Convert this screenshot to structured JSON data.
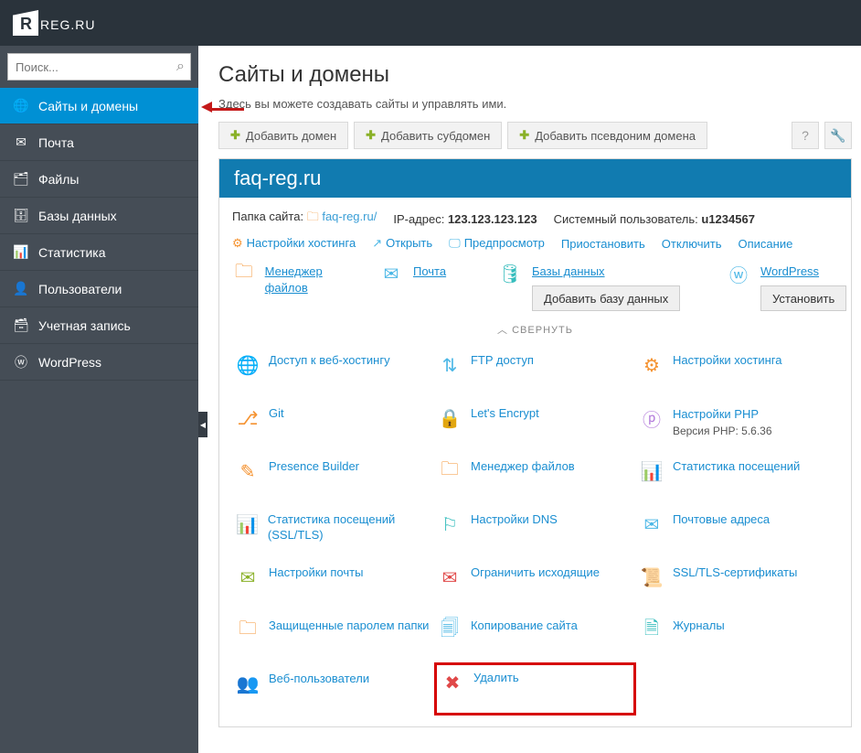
{
  "brand": {
    "name": "REG",
    "suffix": ".RU"
  },
  "search": {
    "placeholder": "Поиск..."
  },
  "sidebar": {
    "items": [
      {
        "label": "Сайты и домены"
      },
      {
        "label": "Почта"
      },
      {
        "label": "Файлы"
      },
      {
        "label": "Базы данных"
      },
      {
        "label": "Статистика"
      },
      {
        "label": "Пользователи"
      },
      {
        "label": "Учетная запись"
      },
      {
        "label": "WordPress"
      }
    ]
  },
  "page": {
    "title": "Сайты и домены",
    "desc": "Здесь вы можете создавать сайты и управлять ими."
  },
  "toolbar": {
    "add_domain": "Добавить домен",
    "add_subdomain": "Добавить субдомен",
    "add_alias": "Добавить псевдоним домена"
  },
  "domain": {
    "name": "faq-reg.ru",
    "folder_label": "Папка сайта:",
    "folder_link": "faq-reg.ru/",
    "ip_label": "IP-адрес:",
    "ip_value": "123.123.123.123",
    "sysuser_label": "Системный пользователь:",
    "sysuser_value": "u1234567",
    "action_links": {
      "hosting": "Настройки хостинга",
      "open": "Открыть",
      "preview": "Предпросмотр",
      "suspend": "Приостановить",
      "disable": "Отключить",
      "describe": "Описание"
    },
    "blocks": {
      "fm": "Менеджер файлов",
      "mail": "Почта",
      "db": "Базы данных",
      "db_btn": "Добавить базу данных",
      "wp": "WordPress",
      "wp_btn": "Установить"
    },
    "collapse": "СВЕРНУТЬ"
  },
  "grid": [
    {
      "label": "Доступ к веб-хостингу"
    },
    {
      "label": "FTP доступ"
    },
    {
      "label": "Настройки хостинга"
    },
    {
      "label": "Git"
    },
    {
      "label": "Let's Encrypt"
    },
    {
      "label": "Настройки PHP",
      "sub": "Версия PHP: 5.6.36"
    },
    {
      "label": "Presence Builder"
    },
    {
      "label": "Менеджер файлов"
    },
    {
      "label": "Статистика посещений"
    },
    {
      "label": "Статистика посещений (SSL/TLS)"
    },
    {
      "label": "Настройки DNS"
    },
    {
      "label": "Почтовые адреса"
    },
    {
      "label": "Настройки почты"
    },
    {
      "label": "Ограничить исходящие"
    },
    {
      "label": "SSL/TLS-сертификаты"
    },
    {
      "label": "Защищенные паролем папки"
    },
    {
      "label": "Копирование сайта"
    },
    {
      "label": "Журналы"
    },
    {
      "label": "Веб-пользователи"
    },
    {
      "label": "Удалить"
    }
  ]
}
